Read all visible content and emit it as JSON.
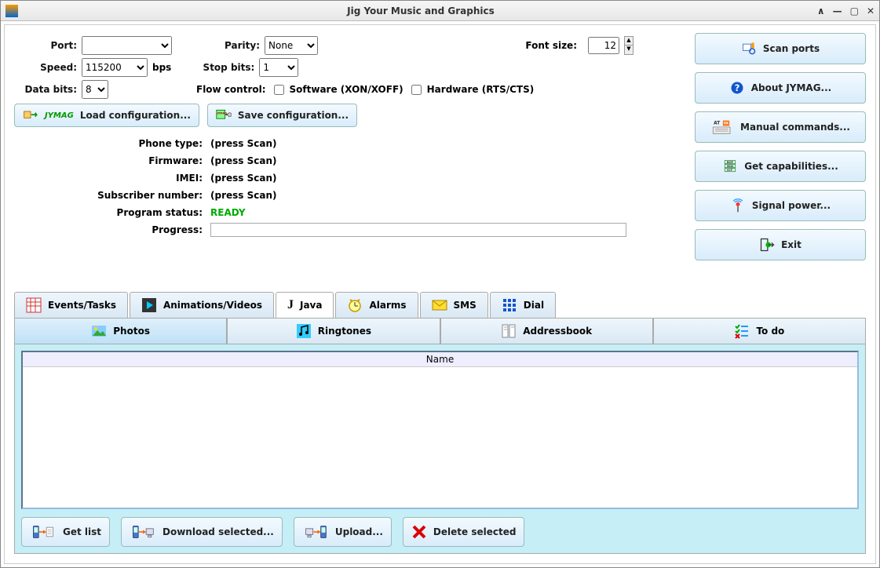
{
  "window": {
    "title": "Jig Your Music and Graphics"
  },
  "port": {
    "port_label": "Port:",
    "port_value": "",
    "speed_label": "Speed:",
    "speed_value": "115200",
    "speed_unit": "bps",
    "databits_label": "Data bits:",
    "databits_value": "8",
    "parity_label": "Parity:",
    "parity_value": "None",
    "stopbits_label": "Stop bits:",
    "stopbits_value": "1",
    "flow_label": "Flow control:",
    "flow_sw": "Software (XON/XOFF)",
    "flow_hw": "Hardware (RTS/CTS)"
  },
  "font": {
    "label": "Font size:",
    "value": "12"
  },
  "cfg": {
    "load": "Load configuration...",
    "save": "Save configuration..."
  },
  "info": {
    "phone_type_lbl": "Phone type:",
    "phone_type": "(press Scan)",
    "firmware_lbl": "Firmware:",
    "firmware": "(press Scan)",
    "imei_lbl": "IMEI:",
    "imei": "(press Scan)",
    "sub_lbl": "Subscriber number:",
    "sub": "(press Scan)",
    "status_lbl": "Program status:",
    "status": "READY",
    "progress_lbl": "Progress:"
  },
  "side": {
    "scan": "Scan ports",
    "about": "About JYMAG...",
    "manual": "Manual commands...",
    "caps": "Get capabilities...",
    "signal": "Signal power...",
    "exit": "Exit"
  },
  "tabs1": {
    "events": "Events/Tasks",
    "anim": "Animations/Videos",
    "java": "Java",
    "alarms": "Alarms",
    "sms": "SMS",
    "dial": "Dial"
  },
  "tabs2": {
    "photos": "Photos",
    "ring": "Ringtones",
    "addr": "Addressbook",
    "todo": "To do"
  },
  "table": {
    "col_name": "Name"
  },
  "actions": {
    "get": "Get list",
    "download": "Download selected...",
    "upload": "Upload...",
    "delete": "Delete selected"
  }
}
